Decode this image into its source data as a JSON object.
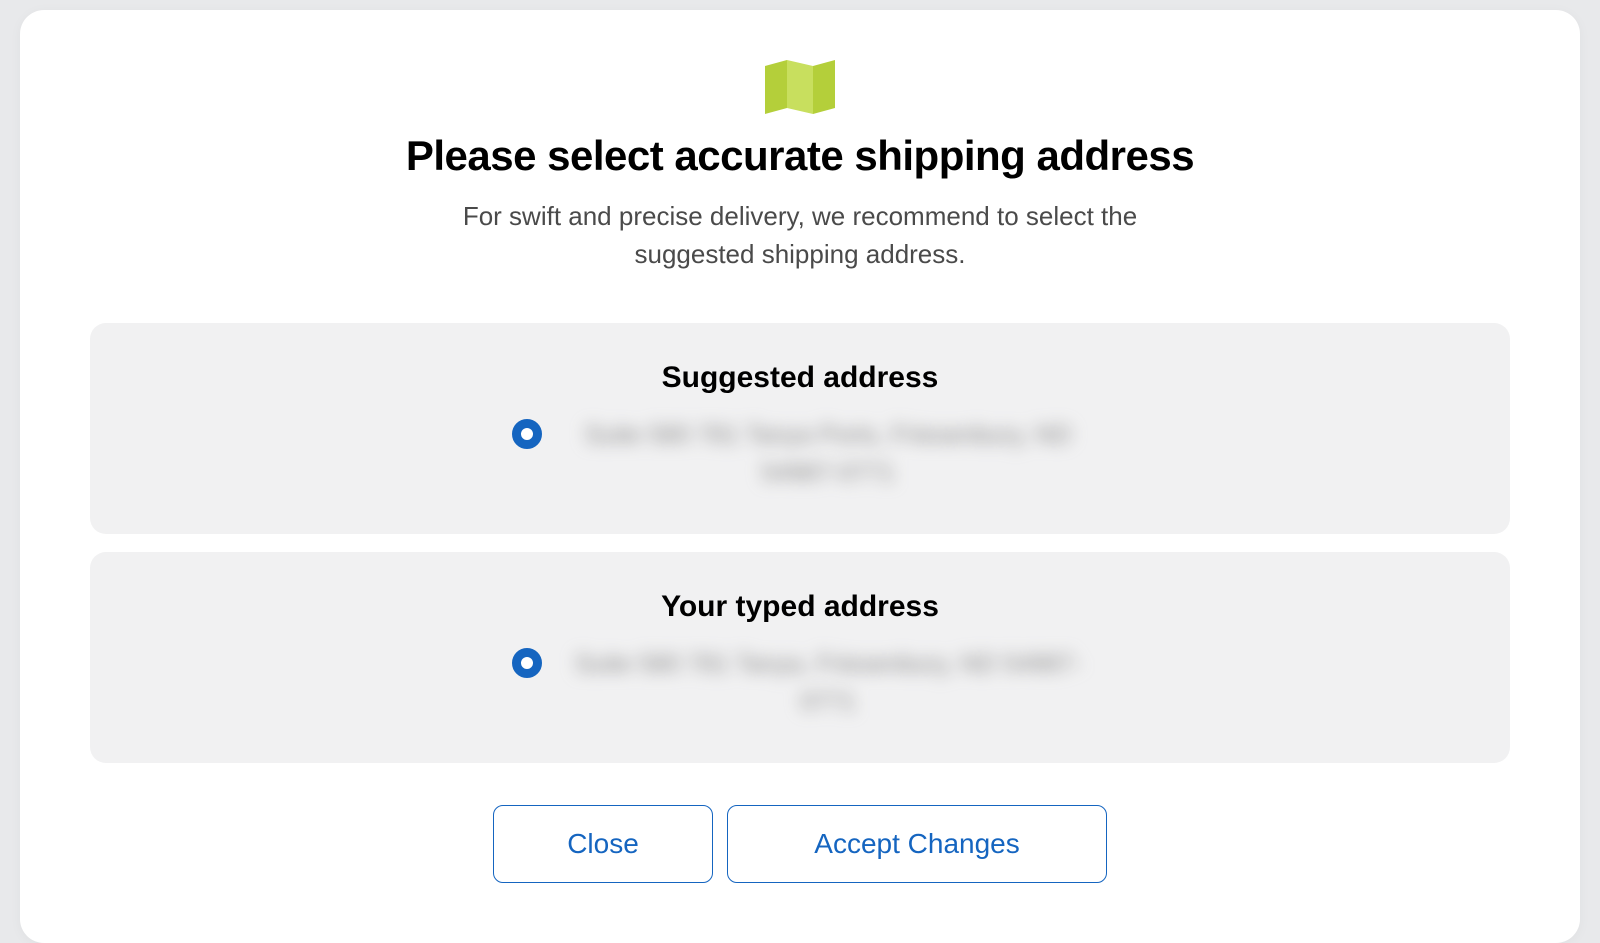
{
  "modal": {
    "title": "Please select accurate shipping address",
    "subtitle": "For swift and precise delivery, we recommend to select the suggested shipping address."
  },
  "options": {
    "suggested": {
      "label": "Suggested address",
      "blurred_sample": "Suite 580 781 Tanya Ports, Friesenbury, ND 54987-0771"
    },
    "typed": {
      "label": "Your typed address",
      "blurred_sample": "Suite 580 781 Tanya, Friesenbury, ND 54987-0771"
    }
  },
  "actions": {
    "close": "Close",
    "accept": "Accept Changes"
  },
  "colors": {
    "accent_green": "#b4cf3a",
    "accent_blue": "#1565c0"
  }
}
